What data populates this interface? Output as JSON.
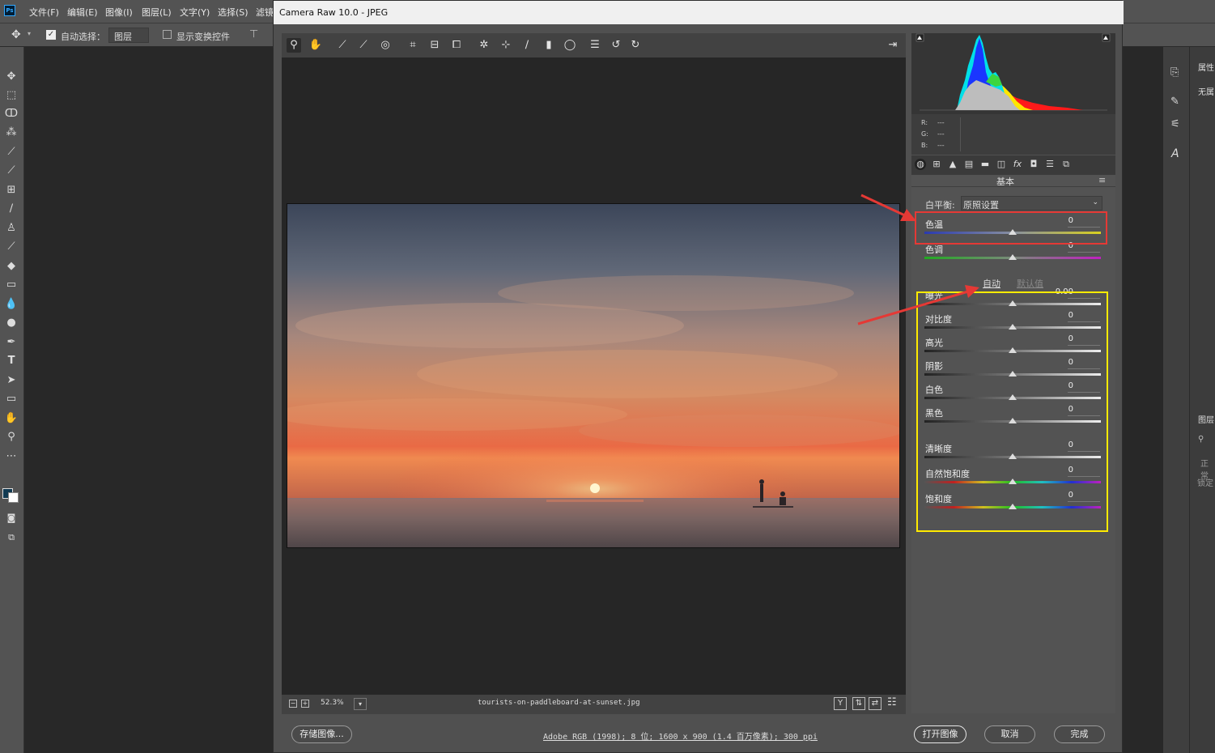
{
  "photoshop": {
    "menus": [
      "文件(F)",
      "编辑(E)",
      "图像(I)",
      "图层(L)",
      "文字(Y)",
      "选择(S)",
      "滤镜"
    ],
    "options": {
      "auto_select_label": "自动选择：",
      "auto_select_value": "图层",
      "show_transform_label": "显示变换控件"
    },
    "right_panel": {
      "properties_tab": "属性",
      "properties_value": "无属",
      "layers_tab": "图层",
      "blend_mode": "正常",
      "lock_label": "锁定"
    },
    "logo": "Ps"
  },
  "dialog": {
    "title": "Camera Raw 10.0 -  JPEG",
    "zoom": "52.3%",
    "filename": "tourists-on-paddleboard-at-sunset.jpg",
    "file_info": "Adobe RGB (1998); 8 位; 1600 x 900 (1.4 百万像素); 300 ppi",
    "buttons": {
      "save": "存储图像...",
      "open": "打开图像",
      "cancel": "取消",
      "done": "完成"
    },
    "rgb_readout": {
      "r": "R:",
      "g": "G:",
      "b": "B:",
      "r_val": "---",
      "g_val": "---",
      "b_val": "---"
    },
    "panel_title": "基本",
    "white_balance": {
      "label": "白平衡:",
      "value": "原照设置"
    },
    "auto_label": "自动",
    "default_label": "默认值",
    "sliders": [
      {
        "label": "色温",
        "value": "0",
        "level": 0.5,
        "track": "temp"
      },
      {
        "label": "色调",
        "value": "0",
        "level": 0.5,
        "track": "tint"
      },
      {
        "label": "曝光",
        "value": "0.00",
        "level": 0.5,
        "track": "gray"
      },
      {
        "label": "对比度",
        "value": "0",
        "level": 0.5,
        "track": "gray"
      },
      {
        "label": "高光",
        "value": "0",
        "level": 0.5,
        "track": "gray"
      },
      {
        "label": "阴影",
        "value": "0",
        "level": 0.5,
        "track": "gray"
      },
      {
        "label": "白色",
        "value": "0",
        "level": 0.5,
        "track": "gray"
      },
      {
        "label": "黑色",
        "value": "0",
        "level": 0.5,
        "track": "gray"
      },
      {
        "label": "清晰度",
        "value": "0",
        "level": 0.5,
        "track": "gray"
      },
      {
        "label": "自然饱和度",
        "value": "0",
        "level": 0.5,
        "track": "rainbow"
      },
      {
        "label": "饱和度",
        "value": "0",
        "level": 0.5,
        "track": "rainbow"
      }
    ]
  },
  "colors": {
    "annotation_red": "#e53935",
    "annotation_yellow": "#ffeb00",
    "accent": "#31a8ff"
  }
}
